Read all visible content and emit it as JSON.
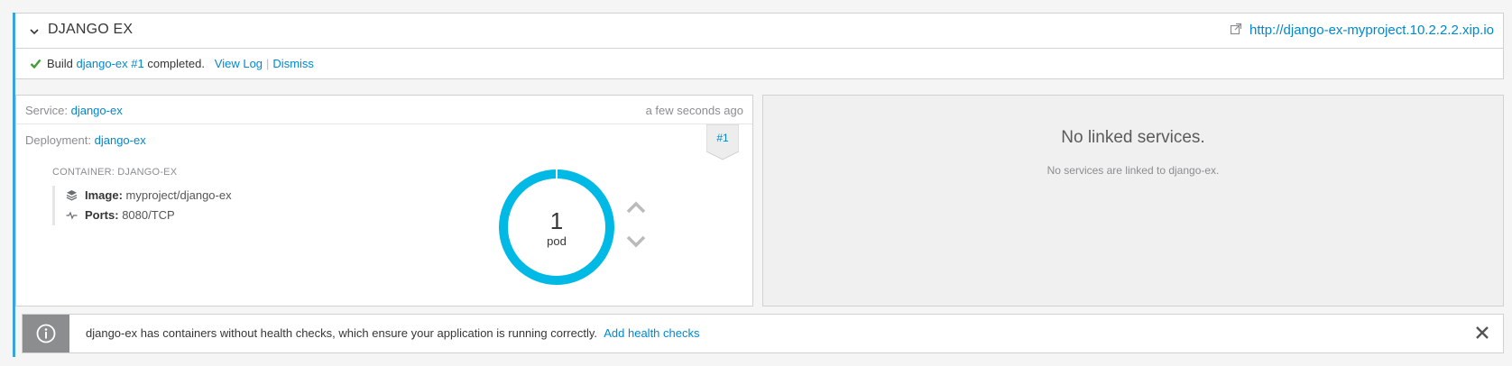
{
  "app": {
    "name": "DJANGO EX",
    "route_url": "http://django-ex-myproject.10.2.2.2.xip.io"
  },
  "build": {
    "prefix": "Build",
    "name": "django-ex #1",
    "status_text": "completed.",
    "view_log_label": "View Log",
    "separator": "|",
    "dismiss_label": "Dismiss"
  },
  "service": {
    "label": "Service:",
    "name": "django-ex",
    "timestamp": "a few seconds ago"
  },
  "deployment": {
    "label": "Deployment:",
    "name": "django-ex",
    "badge": "#1"
  },
  "container": {
    "title": "CONTAINER: DJANGO-EX",
    "image_label": "Image:",
    "image_value": "myproject/django-ex",
    "ports_label": "Ports:",
    "ports_value": "8080/TCP"
  },
  "pods": {
    "count": "1",
    "label": "pod",
    "ring_color": "#00b9e4"
  },
  "linked_services": {
    "title": "No linked services.",
    "subtitle": "No services are linked to django-ex."
  },
  "health_alert": {
    "message": "django-ex has containers without health checks, which ensure your application is running correctly.",
    "action_label": "Add health checks"
  },
  "icons": {
    "collapse": "chevron-down-icon",
    "external_link": "external-link-icon",
    "build_status": "check-icon",
    "image": "layers-icon",
    "ports": "pulse-icon",
    "scale_up": "chevron-up-icon",
    "scale_down": "chevron-down-icon",
    "alert": "info-icon",
    "dismiss_alert": "close-icon"
  },
  "colors": {
    "accent": "#39a5dc",
    "link": "#0088ce",
    "success": "#3f9c35",
    "pod_ring": "#00b9e4"
  }
}
